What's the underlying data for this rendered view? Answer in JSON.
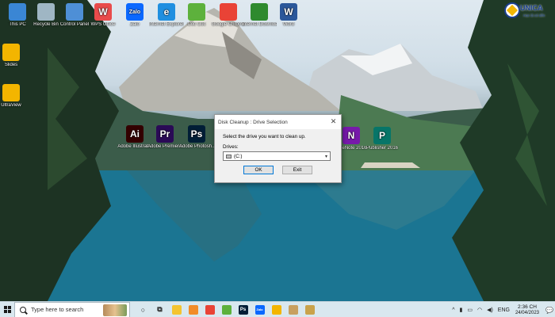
{
  "wallpaper": {
    "sky": "#d6e2ea",
    "lake": "#18708a"
  },
  "logo": {
    "name": "UNICA",
    "tagline": "Học là có tiền"
  },
  "desktop_icons": [
    {
      "id": "this-pc",
      "label": "This PC",
      "icon": "computer-icon",
      "color": "#3a86d4",
      "glyph": ""
    },
    {
      "id": "recycle",
      "label": "Recycle Bin",
      "icon": "recycle-bin-icon",
      "color": "#9fb6c4",
      "glyph": ""
    },
    {
      "id": "control",
      "label": "Control Panel",
      "icon": "control-panel-icon",
      "color": "#4e8fd6",
      "glyph": ""
    },
    {
      "id": "wps",
      "label": "WPS Office",
      "icon": "wps-office-icon",
      "color": "#e94b4b",
      "glyph": "W"
    },
    {
      "id": "zalo",
      "label": "Zalo",
      "icon": "zalo-icon",
      "color": "#0a68ff",
      "glyph": "Zalo"
    },
    {
      "id": "ie",
      "label": "Internet Explorer",
      "icon": "internet-explorer-icon",
      "color": "#1f8fe0",
      "glyph": "e"
    },
    {
      "id": "coccoc",
      "label": "Cốc Cốc",
      "icon": "coccoc-icon",
      "color": "#5db13c",
      "glyph": ""
    },
    {
      "id": "chrome",
      "label": "Google Chrome",
      "icon": "chrome-icon",
      "color": "#e94336",
      "glyph": ""
    },
    {
      "id": "idm",
      "label": "Internet Download Manager",
      "icon": "idm-icon",
      "color": "#2e8a2e",
      "glyph": ""
    },
    {
      "id": "word",
      "label": "Word",
      "icon": "word-icon",
      "color": "#2b579a",
      "glyph": "W"
    },
    {
      "id": "slides",
      "label": "Slides",
      "icon": "slides-icon",
      "color": "#f3b500",
      "glyph": ""
    },
    {
      "id": "ultraview",
      "label": "UltraView",
      "icon": "ultraview-icon",
      "color": "#f3b500",
      "glyph": ""
    },
    {
      "id": "illustrator",
      "label": "Adobe Illustrat...",
      "icon": "illustrator-icon",
      "color": "#330000",
      "glyph": "Ai"
    },
    {
      "id": "premiere",
      "label": "Adobe Premiere Pr...",
      "icon": "premiere-icon",
      "color": "#2a0a56",
      "glyph": "Pr"
    },
    {
      "id": "photoshop",
      "label": "Adobe Photosh...",
      "icon": "photoshop-icon",
      "color": "#001e36",
      "glyph": "Ps"
    },
    {
      "id": "onenote",
      "label": "OneNote 2016",
      "icon": "onenote-icon",
      "color": "#7719aa",
      "glyph": "N"
    },
    {
      "id": "publisher",
      "label": "Publisher 2016",
      "icon": "publisher-icon",
      "color": "#077568",
      "glyph": "P"
    }
  ],
  "dialog": {
    "title": "Disk Cleanup : Drive Selection",
    "close_glyph": "✕",
    "prompt": "Select the drive you want to clean up.",
    "drives_label": "Drives:",
    "selected_drive": "(C:)",
    "ok_label": "OK",
    "exit_label": "Exit"
  },
  "taskbar": {
    "search_placeholder": "Type here to search",
    "pinned": [
      {
        "name": "cortana-icon",
        "glyph": "○",
        "color": "#222"
      },
      {
        "name": "task-view-icon",
        "glyph": "⧉",
        "color": "#222"
      },
      {
        "name": "file-explorer-icon",
        "glyph": "",
        "color": "#f4c430"
      },
      {
        "name": "store-icon",
        "glyph": "",
        "color": "#f28c28"
      },
      {
        "name": "chrome-icon",
        "glyph": "",
        "color": "#e94336"
      },
      {
        "name": "coccoc-icon",
        "glyph": "",
        "color": "#5db13c"
      },
      {
        "name": "photoshop-icon",
        "glyph": "Ps",
        "color": "#001e36"
      },
      {
        "name": "zalo-icon",
        "glyph": "Zalo",
        "color": "#0a68ff"
      },
      {
        "name": "ultraview-icon",
        "glyph": "",
        "color": "#f3b500"
      },
      {
        "name": "paint-icon",
        "glyph": "",
        "color": "#c8a060"
      },
      {
        "name": "tool-icon",
        "glyph": "",
        "color": "#c9a24b"
      }
    ],
    "tray": {
      "chevron": "^",
      "lang": "ENG",
      "time": "2:36 CH",
      "date": "24/04/2023",
      "notification_glyph": "💬"
    }
  }
}
